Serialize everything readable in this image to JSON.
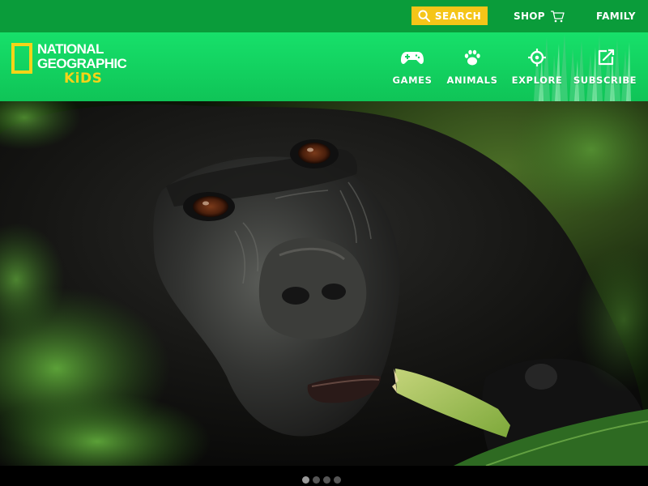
{
  "utility_bar": {
    "search_label": "SEARCH",
    "shop_label": "SHOP",
    "family_label": "FAMILY",
    "search_icon": "search-icon",
    "cart_icon": "cart-icon"
  },
  "logo": {
    "line1": "NATIONAL",
    "line2": "GEOGRAPHIC",
    "line3": "KiDS"
  },
  "nav": {
    "items": [
      {
        "label": "GAMES",
        "icon": "gamepad-icon"
      },
      {
        "label": "ANIMALS",
        "icon": "paw-icon"
      },
      {
        "label": "EXPLORE",
        "icon": "compass-icon"
      },
      {
        "label": "SUBSCRIBE",
        "icon": "subscribe-icon"
      }
    ]
  },
  "hero": {
    "subject": "gorilla",
    "slide_count": 4,
    "active_slide": 1
  },
  "colors": {
    "utility_bar": "#0a9c3a",
    "header": "#17e06a",
    "search_button": "#f5c518",
    "logo_yellow": "#f5d418"
  }
}
